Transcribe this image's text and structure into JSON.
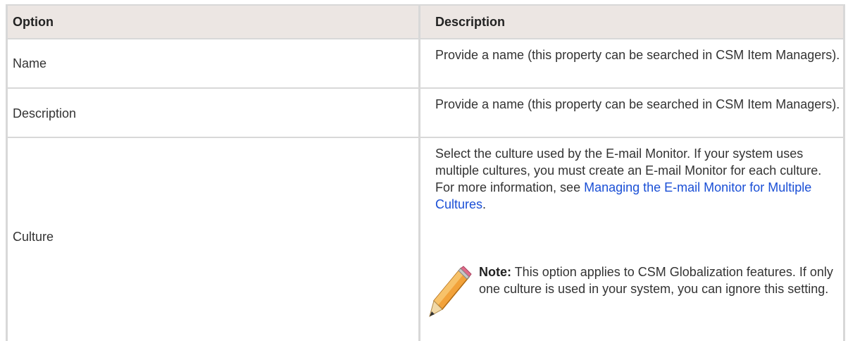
{
  "table": {
    "headers": {
      "option": "Option",
      "description": "Description"
    },
    "rows": [
      {
        "option": "Name",
        "description": "Provide a name (this property can be searched in CSM Item Managers)."
      },
      {
        "option": "Description",
        "description": "Provide a name (this property can be searched in CSM Item Managers)."
      },
      {
        "option": "Culture",
        "description": "Select the culture used by the E-mail Monitor. If your system uses multiple cultures, you must create an E-mail Monitor for each culture. For more information, see",
        "link": "Managing the E-mail Monitor for Multiple Cultures",
        "after_link": ".",
        "note_label": "Note:",
        "note_text": "This option applies to CSM Globalization features. If only one culture is used in your system, you can ignore this setting.",
        "note_icon": "pencil-icon"
      }
    ]
  }
}
